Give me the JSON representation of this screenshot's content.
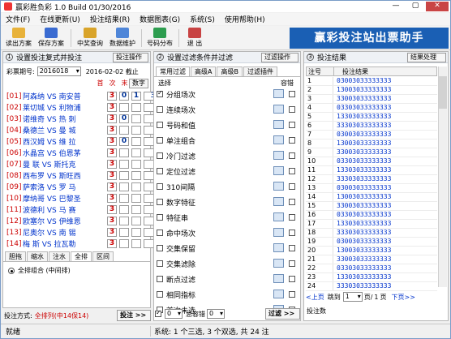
{
  "window": {
    "title": "赢彩胜负彩 1.0 Build 01/30/2016",
    "controls": [
      "—",
      "▢",
      "✕"
    ]
  },
  "menu": [
    "文件(F)",
    "在线更新(U)",
    "投注结果(R)",
    "数据图表(G)",
    "系统(S)",
    "使用帮助(H)"
  ],
  "toolbar": {
    "buttons": [
      {
        "label": "读出方案",
        "icon": "folder-open-icon",
        "color": "#e8b23a"
      },
      {
        "label": "保存方案",
        "icon": "save-icon",
        "color": "#3a6bd1"
      },
      {
        "label": "中奖查询",
        "icon": "medal-icon",
        "color": "#d9a42a"
      },
      {
        "label": "数据维护",
        "icon": "database-icon",
        "color": "#4f86d8"
      },
      {
        "label": "号码分布",
        "icon": "chart-icon",
        "color": "#2d9d4f"
      },
      {
        "label": "退 出",
        "icon": "exit-icon",
        "color": "#c84343"
      }
    ],
    "banner": "赢彩投注站出票助手"
  },
  "left_panel": {
    "header": "设置投注复式并投注",
    "header_num": "1",
    "dropdown": "投注操作",
    "period_label": "彩票期号:",
    "period_value": "2016018",
    "date": "2016-02-02 截止",
    "col_headers": [
      "首",
      "次",
      "末"
    ],
    "number_btn": "数字",
    "matches": [
      {
        "num": "[01]",
        "name": "阿森纳 VS 南安普",
        "c1": "3",
        "c2": "0",
        "c3": "1",
        "val": "301"
      },
      {
        "num": "[02]",
        "name": "莱切城 VS 利物浦",
        "c1": "3",
        "c2": "",
        "c3": "",
        "val": "3"
      },
      {
        "num": "[03]",
        "name": "诺维奇 VS 热 刺",
        "c1": "3",
        "c2": "0",
        "c3": "",
        "val": "30"
      },
      {
        "num": "[04]",
        "name": "桑德兰 VS 曼 城",
        "c1": "3",
        "c2": "",
        "c3": "",
        "val": "3"
      },
      {
        "num": "[05]",
        "name": "西汉姆 VS 维 拉",
        "c1": "3",
        "c2": "0",
        "c3": "",
        "val": "30"
      },
      {
        "num": "[06]",
        "name": "水晶宫 VS 伯恩茅",
        "c1": "3",
        "c2": "",
        "c3": "",
        "val": "3"
      },
      {
        "num": "[07]",
        "name": "曼 联 VS 斯托克",
        "c1": "3",
        "c2": "",
        "c3": "",
        "val": "3"
      },
      {
        "num": "[08]",
        "name": "西布罗 VS 斯旺西",
        "c1": "3",
        "c2": "",
        "c3": "",
        "val": "3"
      },
      {
        "num": "[09]",
        "name": "萨索洛 VS 罗 马",
        "c1": "3",
        "c2": "",
        "c3": "",
        "val": "3"
      },
      {
        "num": "[10]",
        "name": "摩纳哥 VS 巴黎圣",
        "c1": "3",
        "c2": "",
        "c3": "",
        "val": "3"
      },
      {
        "num": "[11]",
        "name": "波德利 VS 马 赛",
        "c1": "3",
        "c2": "",
        "c3": "",
        "val": "3"
      },
      {
        "num": "[12]",
        "name": "欧塞尔 VS 伊维恩",
        "c1": "3",
        "c2": "",
        "c3": "",
        "val": "3"
      },
      {
        "num": "[13]",
        "name": "尼奥尔 VS 南 锡",
        "c1": "3",
        "c2": "",
        "c3": "",
        "val": "3"
      },
      {
        "num": "[14]",
        "name": "梅 斯 VS 拉瓦勒",
        "c1": "3",
        "c2": "",
        "c3": "",
        "val": "3"
      }
    ],
    "tabs": [
      "胆拖",
      "缩水",
      "注水",
      "全排",
      "区间"
    ],
    "active_tab": "全排",
    "radio_label": "全排组合 (中间排)",
    "bet_label": "投注方式:",
    "bet_value": "全排列(中14保14)",
    "bet_button": "投注 >>"
  },
  "middle_panel": {
    "header": "设置过滤条件并过滤",
    "header_num": "2",
    "dropdown": "过滤操作",
    "tabs": [
      "常用过滤",
      "高级A",
      "高级B",
      "过滤插件"
    ],
    "active_tab": "常用过滤",
    "col_select": "选择",
    "col_fault": "容错",
    "filters": [
      {
        "label": "分组场次",
        "checked": true
      },
      {
        "label": "连续场次",
        "checked": false
      },
      {
        "label": "号码和值",
        "checked": false
      },
      {
        "label": "单注组合",
        "checked": false
      },
      {
        "label": "冷门过滤",
        "checked": false
      },
      {
        "label": "定位过滤",
        "checked": false
      },
      {
        "label": "310间隔",
        "checked": false
      },
      {
        "label": "数字特征",
        "checked": false
      },
      {
        "label": "特征串",
        "checked": false
      },
      {
        "label": "命中场次",
        "checked": false
      },
      {
        "label": "交集保留",
        "checked": false
      },
      {
        "label": "交集滤除",
        "checked": false
      },
      {
        "label": "断点过滤",
        "checked": false
      },
      {
        "label": "相同指标",
        "checked": false
      },
      {
        "label": "首次未选",
        "checked": false
      }
    ],
    "bottom_value": "0",
    "fault_label": "总容错",
    "fault_value": "0",
    "filter_button": "过滤 >>"
  },
  "right_panel": {
    "header": "投注结果",
    "header_num": "3",
    "dropdown": "结果处理",
    "col_no": "注号",
    "col_result": "投注结果",
    "results": [
      [
        "1",
        "03003033333333"
      ],
      [
        "2",
        "13003033333333"
      ],
      [
        "3",
        "33003033333333"
      ],
      [
        "4",
        "03303033333333"
      ],
      [
        "5",
        "13303033333333"
      ],
      [
        "6",
        "33303033333333"
      ],
      [
        "7",
        "03003033333333"
      ],
      [
        "8",
        "13003033333333"
      ],
      [
        "9",
        "33003033333333"
      ],
      [
        "10",
        "03303033333333"
      ],
      [
        "11",
        "13303033333333"
      ],
      [
        "12",
        "33303033333333"
      ],
      [
        "13",
        "03003033333333"
      ],
      [
        "14",
        "13003033333333"
      ],
      [
        "15",
        "33003033333333"
      ],
      [
        "16",
        "03303033333333"
      ],
      [
        "17",
        "13303033333333"
      ],
      [
        "18",
        "33303033333333"
      ],
      [
        "19",
        "03003033333333"
      ],
      [
        "20",
        "13003033333333"
      ],
      [
        "21",
        "33003033333333"
      ],
      [
        "22",
        "03303033333333"
      ],
      [
        "23",
        "13303033333333"
      ],
      [
        "24",
        "33303033333333"
      ]
    ],
    "pager_prev": "<上页",
    "pager_goto": "跳到",
    "pager_input": "1",
    "pager_page": "页/",
    "pager_total": "1",
    "pager_unit": "页",
    "pager_next": "下页>>",
    "bottom_label": "投注数"
  },
  "status": {
    "left": "就绪",
    "middle": "系统: 1 个三选, 3 个双选, 共 24 注"
  }
}
